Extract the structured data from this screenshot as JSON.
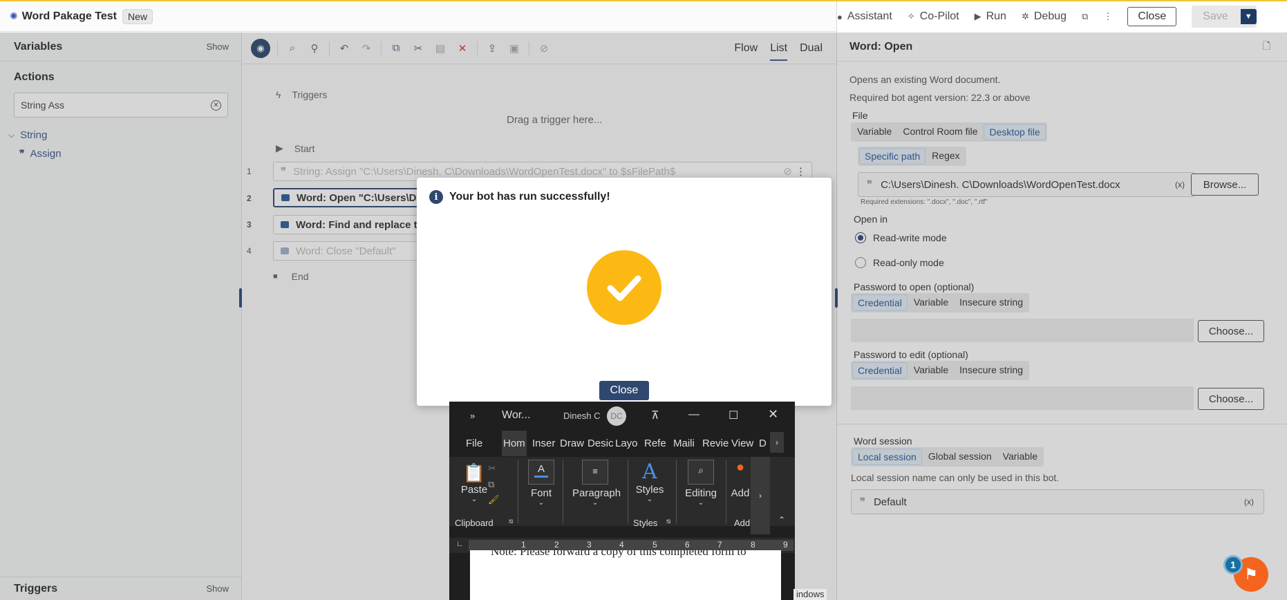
{
  "topbar": {
    "title": "Word Pakage Test",
    "badge": "New",
    "assistant": "Assistant",
    "copilot": "Co-Pilot",
    "run": "Run",
    "debug": "Debug",
    "close": "Close",
    "save": "Save"
  },
  "left": {
    "variables_title": "Variables",
    "variables_show": "Show",
    "actions_title": "Actions",
    "search_value": "String Ass",
    "category": "String",
    "item": "Assign",
    "triggers_title": "Triggers",
    "triggers_show": "Show"
  },
  "center": {
    "view_tabs": [
      "Flow",
      "List",
      "Dual"
    ],
    "active_view": "List",
    "triggers_label": "Triggers",
    "drag_hint": "Drag a trigger here...",
    "start_label": "Start",
    "end_label": "End",
    "steps": [
      {
        "num": "1",
        "text": "String: Assign \"C:\\Users\\Dinesh. C\\Downloads\\WordOpenTest.docx\" to $sFilePath$"
      },
      {
        "num": "2",
        "text": "Word: Open \"C:\\Users\\Di"
      },
      {
        "num": "3",
        "text": "Word: Find and replace te"
      },
      {
        "num": "4",
        "text": "Word: Close \"Default\""
      }
    ]
  },
  "right": {
    "title": "Word: Open",
    "desc": "Opens an existing Word document.",
    "version": "Required bot agent version: 22.3 or above",
    "file_label": "File",
    "file_tabs": [
      "Variable",
      "Control Room file",
      "Desktop file"
    ],
    "path_tabs": [
      "Specific path",
      "Regex"
    ],
    "file_path": "C:\\Users\\Dinesh. C\\Downloads\\WordOpenTest.docx",
    "browse": "Browse...",
    "extensions": "Required extensions: \".docx\", \".doc\", \".rtf\"",
    "open_in_label": "Open in",
    "mode_rw": "Read-write mode",
    "mode_ro": "Read-only mode",
    "pw_open_label": "Password to open (optional)",
    "pw_tabs": [
      "Credential",
      "Variable",
      "Insecure string"
    ],
    "choose": "Choose...",
    "pw_edit_label": "Password to edit (optional)",
    "session_label": "Word session",
    "session_tabs": [
      "Local session",
      "Global session",
      "Variable"
    ],
    "session_note": "Local session name can only be used in this bot.",
    "session_value": "Default",
    "var_marker": "(x)"
  },
  "dialog": {
    "title": "Your bot has run successfully!",
    "close": "Close"
  },
  "word": {
    "title": "Wor...",
    "user": "Dinesh C",
    "initials": "DC",
    "tabs": [
      "File",
      "Hom",
      "Inser",
      "Draw",
      "Desic",
      "Layo",
      "Refe",
      "Maili",
      "Revie",
      "View",
      "D"
    ],
    "groups": {
      "paste": "Paste",
      "clipboard": "Clipboard",
      "font": "Font",
      "paragraph": "Paragraph",
      "styles": "Styles",
      "styles_group": "Styles",
      "editing": "Editing",
      "addins": "Add",
      "add_group": "Add"
    },
    "ruler": [
      "1",
      "2",
      "3",
      "4",
      "5",
      "6",
      "7",
      "8",
      "9"
    ],
    "page_text": "Note: Please forward a copy of this completed form to"
  },
  "windows_label": "indows",
  "fab_badge": "1"
}
